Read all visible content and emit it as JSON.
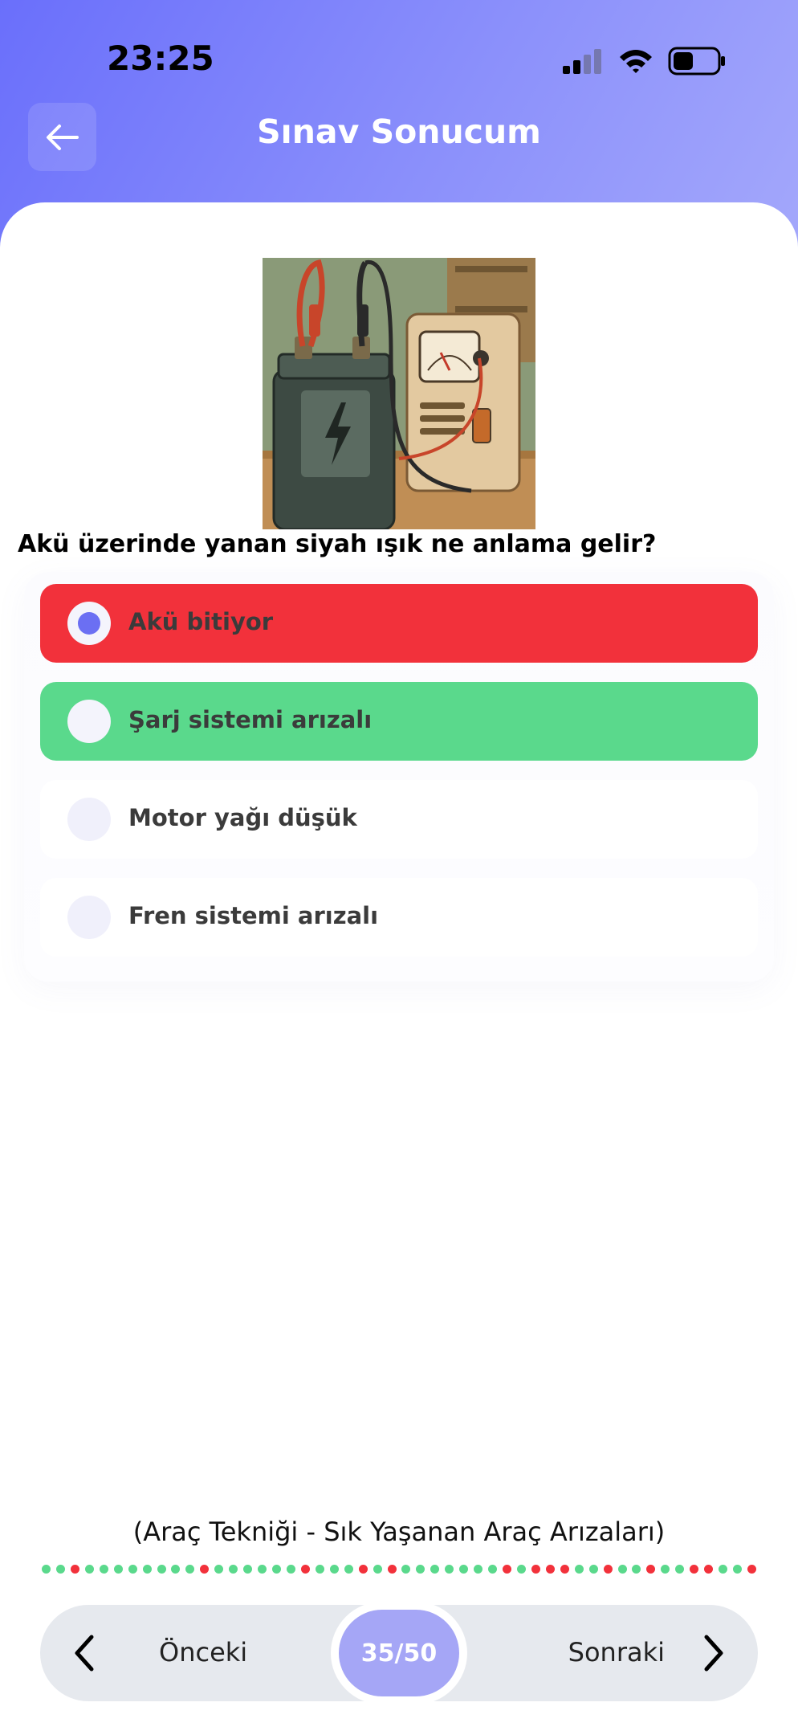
{
  "status_bar": {
    "time": "23:25",
    "icons": [
      "signal-icon",
      "wifi-icon",
      "battery-icon"
    ]
  },
  "header": {
    "title": "Sınav Sonucum",
    "back_icon": "arrow-left-icon"
  },
  "question": {
    "image_desc_icon": "car-battery-charger-illustration",
    "text": "Akü üzerinde yanan siyah ışık ne anlama gelir?",
    "options": [
      {
        "label": "Akü bitiyor",
        "state": "selected-wrong"
      },
      {
        "label": "Şarj sistemi arızalı",
        "state": "correct"
      },
      {
        "label": "Motor yağı düşük",
        "state": "neutral"
      },
      {
        "label": "Fren sistemi arızalı",
        "state": "neutral"
      }
    ]
  },
  "category": "(Araç Tekniği - Sık Yaşanan Araç Arızaları)",
  "progress": {
    "results": [
      "c",
      "c",
      "w",
      "c",
      "c",
      "c",
      "c",
      "c",
      "c",
      "c",
      "c",
      "w",
      "c",
      "c",
      "c",
      "c",
      "c",
      "c",
      "w",
      "c",
      "c",
      "c",
      "w",
      "c",
      "w",
      "c",
      "c",
      "c",
      "c",
      "c",
      "c",
      "c",
      "w",
      "c",
      "w",
      "w",
      "w",
      "c",
      "c",
      "w",
      "c",
      "c",
      "w",
      "c",
      "c",
      "w",
      "w",
      "c",
      "c",
      "w"
    ],
    "colors": {
      "correct": "#5ad98c",
      "wrong": "#f2313b"
    }
  },
  "nav": {
    "prev_label": "Önceki",
    "next_label": "Sonraki",
    "counter": "35/50"
  },
  "colors": {
    "accent": "#6b6ff3",
    "wrong": "#f2313b",
    "correct": "#5ad98c"
  }
}
